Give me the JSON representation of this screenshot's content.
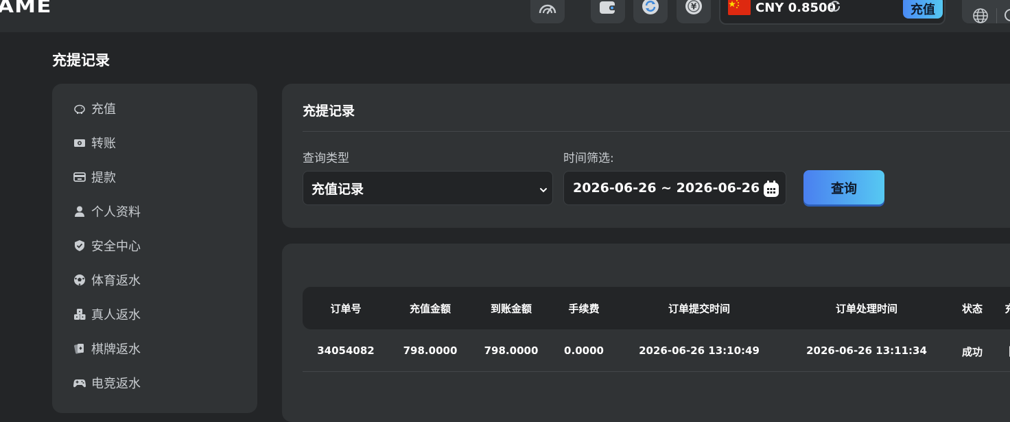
{
  "topbar": {
    "logo_text": "AME",
    "icons": [
      "speedometer-icon",
      "wallet-icon",
      "refresh-icon",
      "yuan-coin-icon",
      "globe-icon"
    ],
    "currency": {
      "code_balance": "CNY 0.8500",
      "flag": "china-flag"
    },
    "deposit_label": "充值"
  },
  "page_title": "充提记录",
  "sidebar": {
    "items": [
      {
        "label": "充值",
        "icon": "piggy-bank-icon"
      },
      {
        "label": "转账",
        "icon": "money-transfer-icon"
      },
      {
        "label": "提款",
        "icon": "withdraw-icon"
      },
      {
        "label": "个人资料",
        "icon": "user-icon"
      },
      {
        "label": "安全中心",
        "icon": "shield-icon"
      },
      {
        "label": "体育返水",
        "icon": "soccer-ball-icon"
      },
      {
        "label": "真人返水",
        "icon": "dice-icon"
      },
      {
        "label": "棋牌返水",
        "icon": "cards-icon"
      },
      {
        "label": "电竞返水",
        "icon": "gamepad-icon"
      }
    ]
  },
  "filter": {
    "title": "充提记录",
    "type_label": "查询类型",
    "type_value": "充值记录",
    "time_label": "时间筛选:",
    "date_range": "2026-06-26 ~ 2026-06-26",
    "query_label": "查询"
  },
  "table": {
    "headers": [
      "订单号",
      "充值金额",
      "到账金额",
      "手续费",
      "订单提交时间",
      "订单处理时间",
      "状态",
      "充"
    ],
    "rows": [
      [
        "34054082",
        "798.0000",
        "798.0000",
        "0.0000",
        "2026-06-26 13:10:49",
        "2026-06-26 13:11:34",
        "成功",
        "|"
      ]
    ]
  },
  "colors": {
    "background": "#232527",
    "panel": "#303335",
    "accent_start": "#4a7ff0",
    "accent_end": "#56c9f2"
  }
}
